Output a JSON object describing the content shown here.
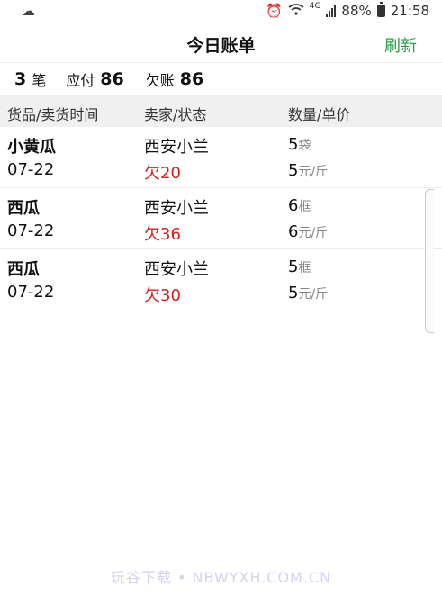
{
  "status_bar": {
    "left_icon": "weather-icon",
    "alarm_icon": "alarm-icon",
    "wifi_icon": "wifi-icon",
    "network": "4G",
    "battery_percent": "88%",
    "time": "21:58"
  },
  "header": {
    "title": "今日账单",
    "refresh_label": "刷新"
  },
  "summary": {
    "count": "3",
    "count_unit": "笔",
    "payable_label": "应付",
    "payable_value": "86",
    "debt_label": "欠账",
    "debt_value": "86"
  },
  "columns": [
    "货品/卖货时间",
    "卖家/状态",
    "数量/单价"
  ],
  "rows": [
    {
      "goods": "小黄瓜",
      "date": "07-22",
      "seller": "西安小兰",
      "status": "欠20",
      "qty": "5",
      "qty_unit": "袋",
      "price": "5",
      "price_unit": "元/斤"
    },
    {
      "goods": "西瓜",
      "date": "07-22",
      "seller": "西安小兰",
      "status": "欠36",
      "qty": "6",
      "qty_unit": "框",
      "price": "6",
      "price_unit": "元/斤"
    },
    {
      "goods": "西瓜",
      "date": "07-22",
      "seller": "西安小兰",
      "status": "欠30",
      "qty": "5",
      "qty_unit": "框",
      "price": "5",
      "price_unit": "元/斤"
    }
  ],
  "watermark": "玩谷下载 • NBWYXH.COM.CN",
  "colors": {
    "accent_green": "#2e9d4e",
    "debt_red": "#d32020",
    "header_bg": "#f0f0f0"
  }
}
